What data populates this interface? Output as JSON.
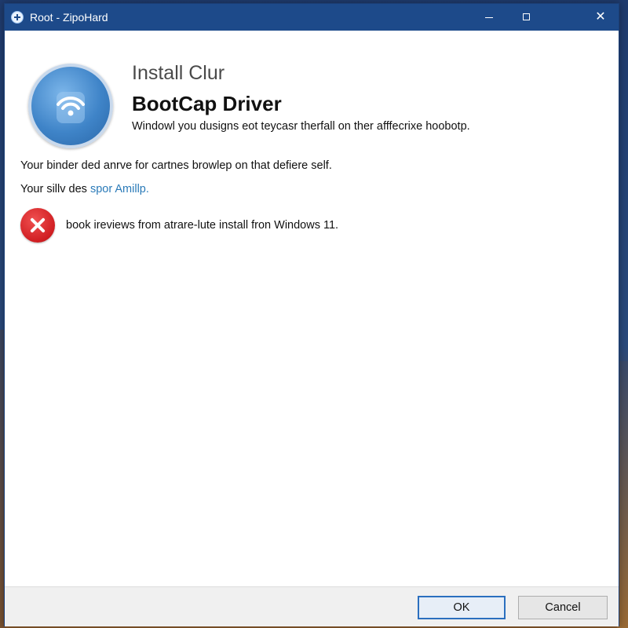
{
  "window": {
    "title": "Root - ZipoHard"
  },
  "titlebar": {
    "minimize_icon": "minimize-icon",
    "maximize_icon": "maximize-icon",
    "close_label": "✕"
  },
  "content": {
    "icon": "driver-wifi-icon",
    "heading_small": "Install Clur",
    "heading_large": "BootCap Driver",
    "description": "Windowl you dusigns eot teycasr therfall on ther afffecrixe hoobotp.",
    "line1": "Your binder ded anrve for cartnes browlep on that defiere self.",
    "line2_prefix": "Your sillv des ",
    "line2_link": "spor Amillp.",
    "error": {
      "icon": "error-x-icon",
      "text": "book ireviews from atrare-lute install fron Windows 11."
    }
  },
  "footer": {
    "ok_label": "OK",
    "cancel_label": "Cancel"
  },
  "colors": {
    "titlebar": "#1d4a8a",
    "link": "#2a7ab8",
    "error": "#d01e22",
    "ok_border": "#2b6fbf"
  }
}
